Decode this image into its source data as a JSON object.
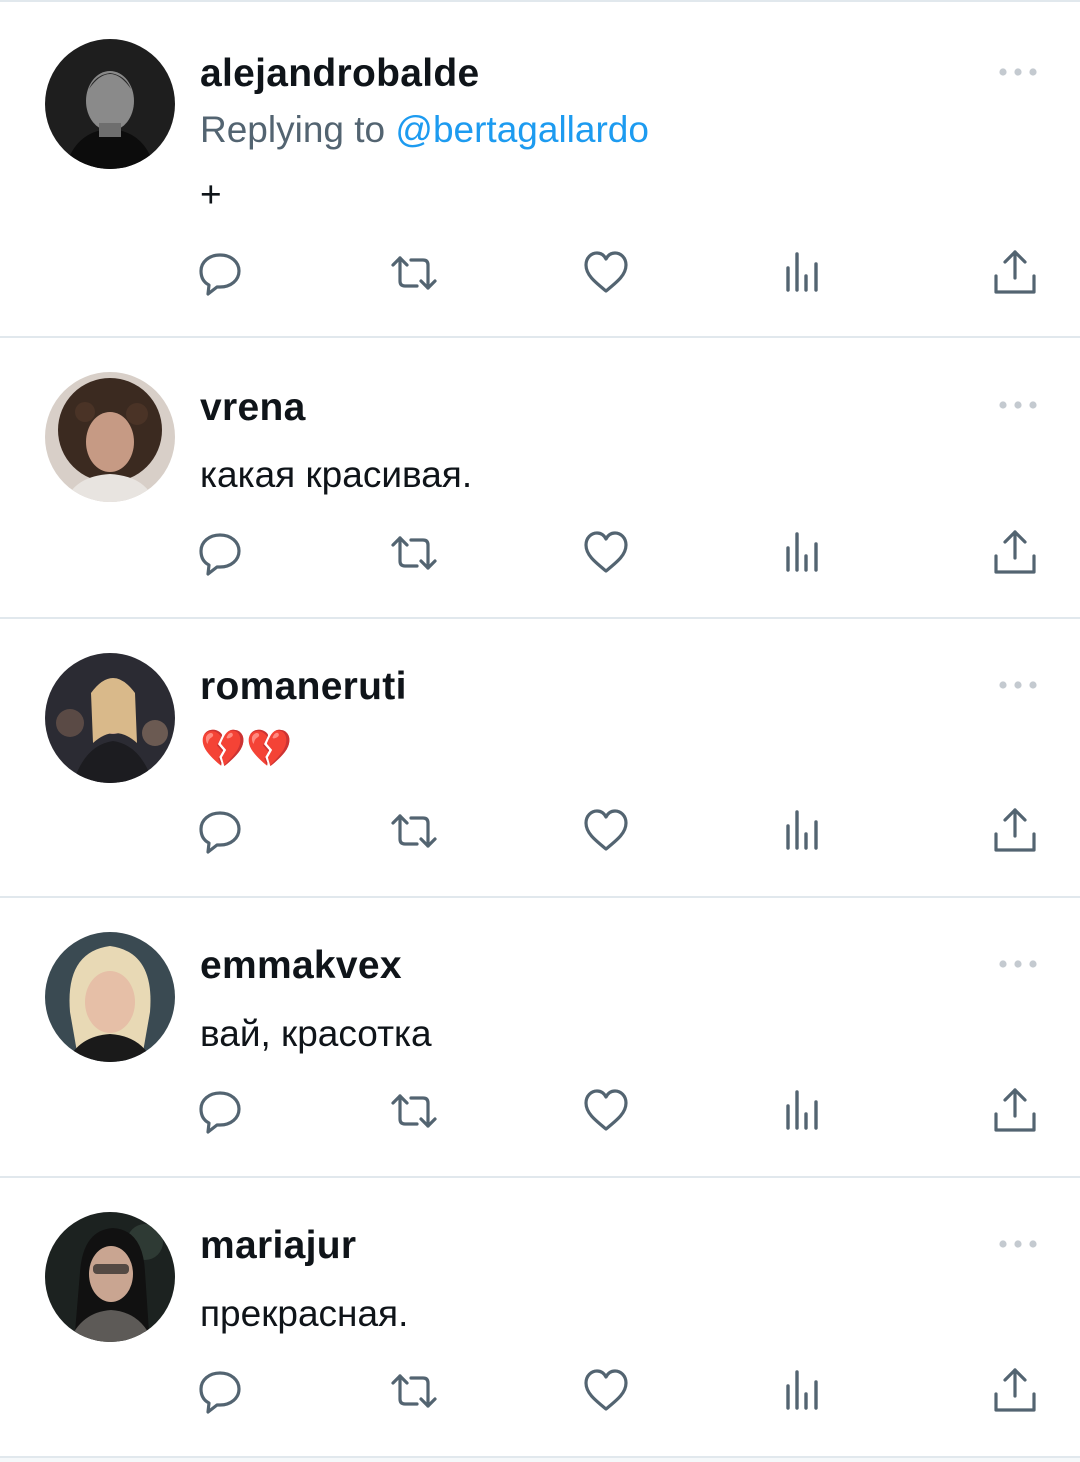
{
  "tweets": [
    {
      "username": "alejandrobalde",
      "replying_prefix": "Replying to",
      "replying_handle": "@bertagallardo",
      "text": "+"
    },
    {
      "username": "vrena",
      "text": "какая красивая."
    },
    {
      "username": "romaneruti",
      "text": "💔💔"
    },
    {
      "username": "emmakvex",
      "text": "вай, красотка"
    },
    {
      "username": "mariajur",
      "text": "прекрасная."
    }
  ],
  "icons": {
    "reply": "reply-icon",
    "retweet": "retweet-icon",
    "like": "heart-icon",
    "views": "views-icon",
    "share": "share-icon",
    "more": "more-dots-icon"
  },
  "colors": {
    "text": "#0f1419",
    "secondary": "#536471",
    "link": "#1d9bf0",
    "divider": "#e1e8ed"
  }
}
